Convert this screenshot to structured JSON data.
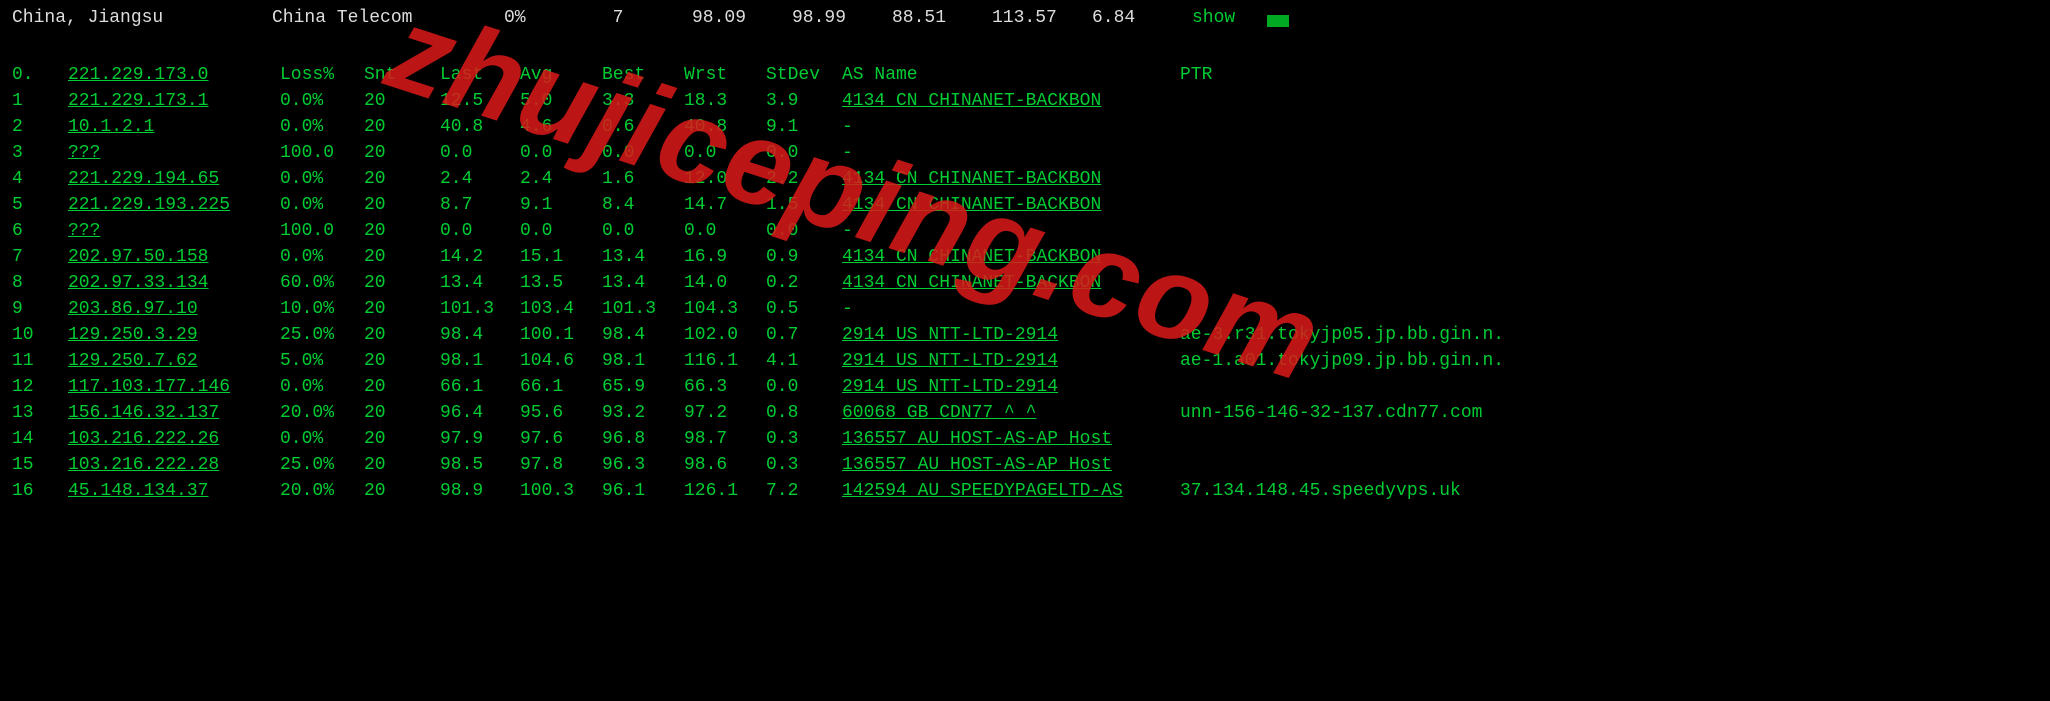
{
  "watermark": "zhujiceping.com",
  "topbar": {
    "location": "China, Jiangsu",
    "isp": "China Telecom",
    "pct": "0%",
    "count": "7",
    "n1": "98.09",
    "n2": "98.99",
    "n3": "88.51",
    "n4": "113.57",
    "n5": "6.84",
    "show": "show"
  },
  "headers": {
    "hop": "0.",
    "ip": "221.229.173.0",
    "loss": "Loss%",
    "snt": "Snt",
    "last": "Last",
    "avg": "Avg",
    "best": "Best",
    "wrst": "Wrst",
    "stdev": "StDev",
    "as": "AS Name",
    "ptr": "PTR"
  },
  "rows": [
    {
      "hop": "1",
      "ip": "221.229.173.1",
      "loss": "0.0%",
      "snt": "20",
      "last": "12.5",
      "avg": "5.0",
      "best": "3.3",
      "wrst": "18.3",
      "stdev": "3.9",
      "as": "4134  CN CHINANET-BACKBON",
      "ptr": ""
    },
    {
      "hop": "2",
      "ip": "10.1.2.1",
      "loss": "0.0%",
      "snt": "20",
      "last": "40.8",
      "avg": "4.6",
      "best": "0.6",
      "wrst": "40.8",
      "stdev": "9.1",
      "as": "-",
      "ptr": ""
    },
    {
      "hop": "3",
      "ip": "???",
      "loss": "100.0",
      "snt": "20",
      "last": "0.0",
      "avg": "0.0",
      "best": "0.0",
      "wrst": "0.0",
      "stdev": "0.0",
      "as": "-",
      "ptr": ""
    },
    {
      "hop": "4",
      "ip": "221.229.194.65",
      "loss": "0.0%",
      "snt": "20",
      "last": "2.4",
      "avg": "2.4",
      "best": "1.6",
      "wrst": "12.0",
      "stdev": "2.2",
      "as": "4134  CN CHINANET-BACKBON",
      "ptr": ""
    },
    {
      "hop": "5",
      "ip": "221.229.193.225",
      "loss": "0.0%",
      "snt": "20",
      "last": "8.7",
      "avg": "9.1",
      "best": "8.4",
      "wrst": "14.7",
      "stdev": "1.5",
      "as": "4134  CN CHINANET-BACKBON",
      "ptr": ""
    },
    {
      "hop": "6",
      "ip": "???",
      "loss": "100.0",
      "snt": "20",
      "last": "0.0",
      "avg": "0.0",
      "best": "0.0",
      "wrst": "0.0",
      "stdev": "0.0",
      "as": "-",
      "ptr": ""
    },
    {
      "hop": "7",
      "ip": "202.97.50.158",
      "loss": "0.0%",
      "snt": "20",
      "last": "14.2",
      "avg": "15.1",
      "best": "13.4",
      "wrst": "16.9",
      "stdev": "0.9",
      "as": "4134  CN CHINANET-BACKBON",
      "ptr": ""
    },
    {
      "hop": "8",
      "ip": "202.97.33.134",
      "loss": "60.0%",
      "snt": "20",
      "last": "13.4",
      "avg": "13.5",
      "best": "13.4",
      "wrst": "14.0",
      "stdev": "0.2",
      "as": "4134  CN CHINANET-BACKBON",
      "ptr": ""
    },
    {
      "hop": "9",
      "ip": "203.86.97.10",
      "loss": "10.0%",
      "snt": "20",
      "last": "101.3",
      "avg": "103.4",
      "best": "101.3",
      "wrst": "104.3",
      "stdev": "0.5",
      "as": "-",
      "ptr": ""
    },
    {
      "hop": "10",
      "ip": "129.250.3.29",
      "loss": "25.0%",
      "snt": "20",
      "last": "98.4",
      "avg": "100.1",
      "best": "98.4",
      "wrst": "102.0",
      "stdev": "0.7",
      "as": "2914  US NTT-LTD-2914",
      "ptr": "ae-3.r31.tokyjp05.jp.bb.gin.n."
    },
    {
      "hop": "11",
      "ip": "129.250.7.62",
      "loss": "5.0%",
      "snt": "20",
      "last": "98.1",
      "avg": "104.6",
      "best": "98.1",
      "wrst": "116.1",
      "stdev": "4.1",
      "as": "2914  US NTT-LTD-2914",
      "ptr": "ae-1.a01.tokyjp09.jp.bb.gin.n."
    },
    {
      "hop": "12",
      "ip": "117.103.177.146",
      "loss": "0.0%",
      "snt": "20",
      "last": "66.1",
      "avg": "66.1",
      "best": "65.9",
      "wrst": "66.3",
      "stdev": "0.0",
      "as": "2914  US NTT-LTD-2914",
      "ptr": ""
    },
    {
      "hop": "13",
      "ip": "156.146.32.137",
      "loss": "20.0%",
      "snt": "20",
      "last": "96.4",
      "avg": "95.6",
      "best": "93.2",
      "wrst": "97.2",
      "stdev": "0.8",
      "as": "60068 GB CDN77 ^_^",
      "ptr": "unn-156-146-32-137.cdn77.com"
    },
    {
      "hop": "14",
      "ip": "103.216.222.26",
      "loss": "0.0%",
      "snt": "20",
      "last": "97.9",
      "avg": "97.6",
      "best": "96.8",
      "wrst": "98.7",
      "stdev": "0.3",
      "as": "136557 AU HOST-AS-AP Host",
      "ptr": ""
    },
    {
      "hop": "15",
      "ip": "103.216.222.28",
      "loss": "25.0%",
      "snt": "20",
      "last": "98.5",
      "avg": "97.8",
      "best": "96.3",
      "wrst": "98.6",
      "stdev": "0.3",
      "as": "136557 AU HOST-AS-AP Host",
      "ptr": ""
    },
    {
      "hop": "16",
      "ip": "45.148.134.37",
      "loss": "20.0%",
      "snt": "20",
      "last": "98.9",
      "avg": "100.3",
      "best": "96.1",
      "wrst": "126.1",
      "stdev": "7.2",
      "as": "142594 AU SPEEDYPAGELTD-AS",
      "ptr": "37.134.148.45.speedyvps.uk"
    }
  ]
}
